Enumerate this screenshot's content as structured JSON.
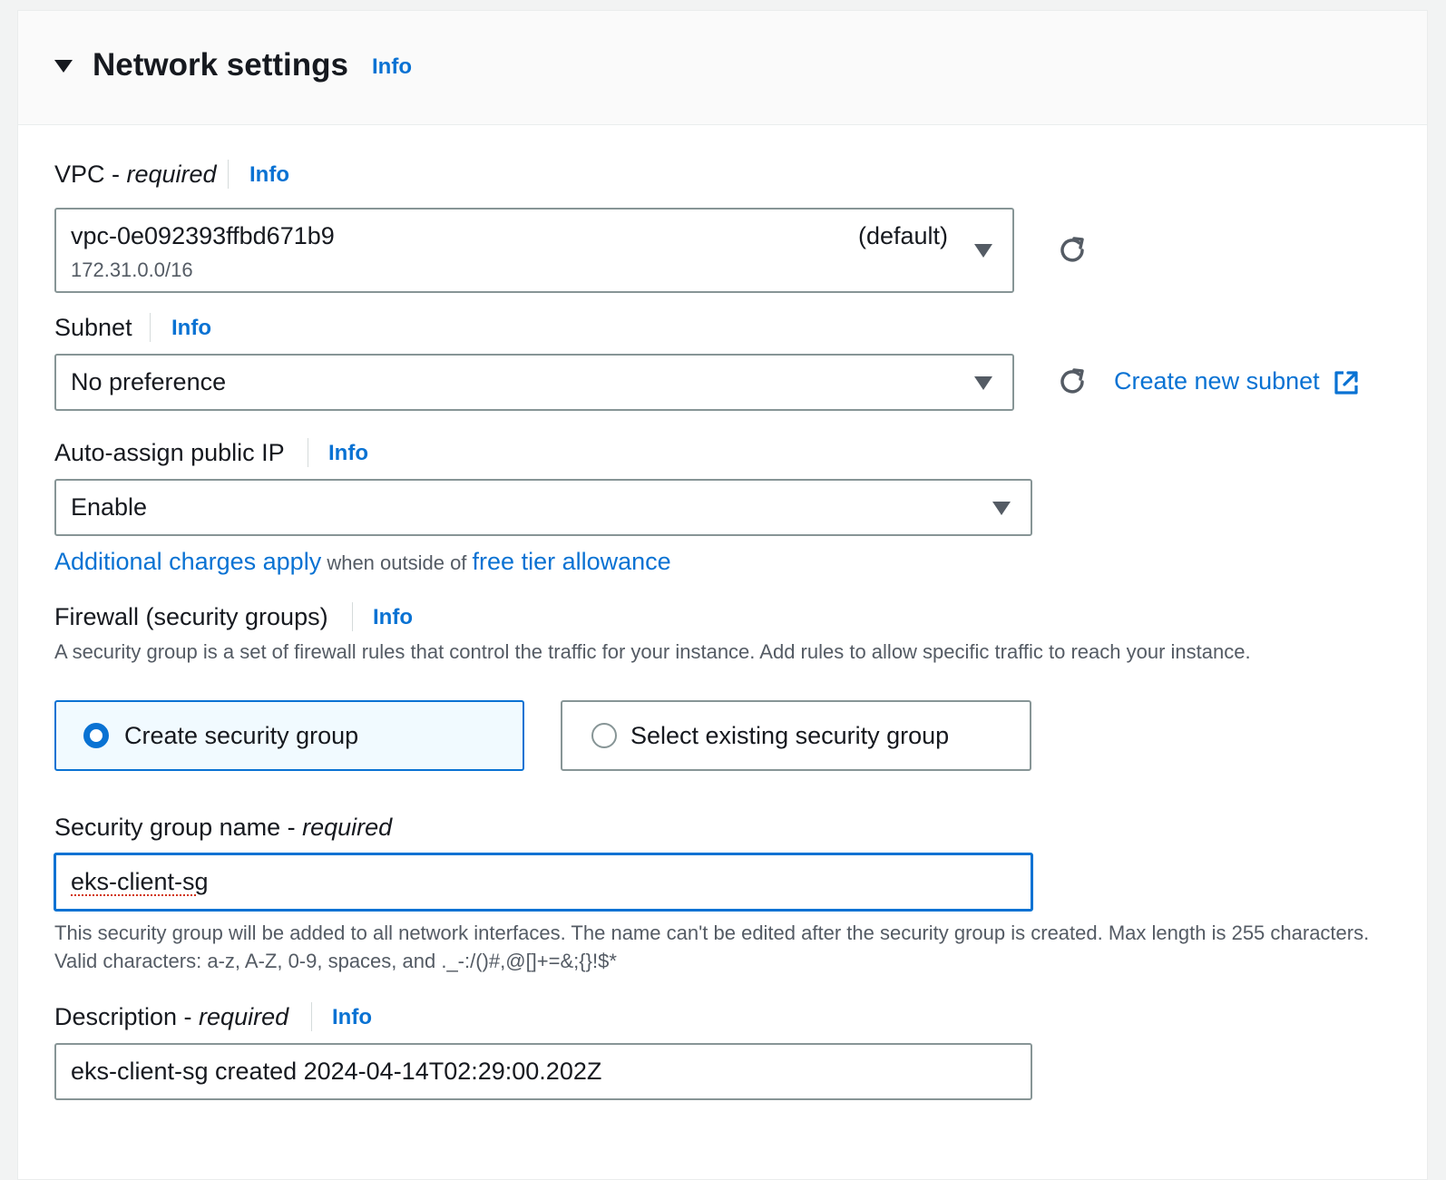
{
  "section": {
    "title": "Network settings",
    "info": "Info"
  },
  "vpc": {
    "label": "VPC - ",
    "required": "required",
    "info": "Info",
    "value": "vpc-0e092393ffbd671b9",
    "tag": "(default)",
    "cidr": "172.31.0.0/16"
  },
  "subnet": {
    "label": "Subnet",
    "info": "Info",
    "value": "No preference",
    "create_link": "Create new subnet"
  },
  "public_ip": {
    "label": "Auto-assign public IP",
    "info": "Info",
    "value": "Enable",
    "charges_link": "Additional charges apply",
    "charges_text": " when outside of ",
    "free_tier_link": "free tier allowance"
  },
  "firewall": {
    "label": "Firewall (security groups)",
    "info": "Info",
    "description": "A security group is a set of firewall rules that control the traffic for your instance. Add rules to allow specific traffic to reach your instance.",
    "option_create": "Create security group",
    "option_select": "Select existing security group"
  },
  "sg_name": {
    "label": "Security group name - ",
    "required": "required",
    "value": "eks-client-sg",
    "help": "This security group will be added to all network interfaces. The name can't be edited after the security group is created. Max length is 255 characters. Valid characters: a-z, A-Z, 0-9, spaces, and ._-:/()#,@[]+=&;{}!$*"
  },
  "description": {
    "label": "Description - ",
    "required": "required",
    "info": "Info",
    "value": "eks-client-sg created 2024-04-14T02:29:00.202Z"
  },
  "colors": {
    "accent": "#0972d3",
    "border": "#879596",
    "text": "#16191f",
    "muted": "#545b64"
  },
  "icons": [
    "caret-down-icon",
    "refresh-icon",
    "dropdown-arrow-icon",
    "external-link-icon",
    "radio-icon"
  ]
}
